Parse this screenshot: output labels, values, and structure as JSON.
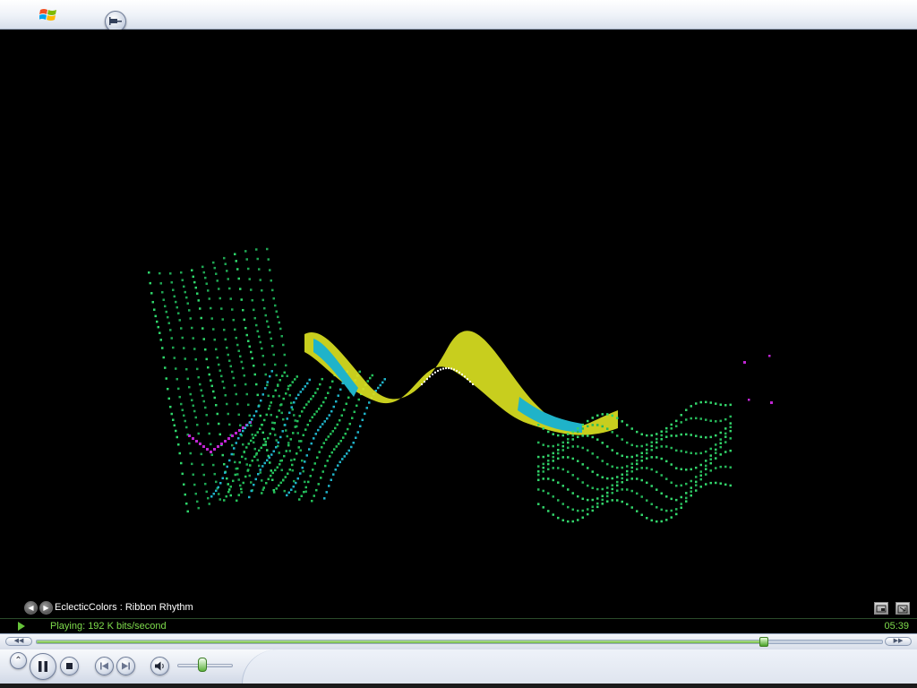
{
  "visualization": {
    "name": "EclecticColors : Ribbon Rhythm"
  },
  "status": {
    "text": "Playing: 192 K bits/second",
    "time": "05:39"
  },
  "seek": {
    "progress": 0.86
  },
  "volume": {
    "level": 0.45
  },
  "icons": {
    "windows_logo": "windows-logo-icon",
    "pin": "pin-icon",
    "prev_visualization": "chevron-left-icon",
    "next_visualization": "chevron-right-icon",
    "play_indicator": "play-icon",
    "rewind": "rewind-icon",
    "fast_forward": "fast-forward-icon",
    "eject": "eject-icon",
    "pause": "pause-icon",
    "stop": "stop-icon",
    "previous": "previous-track-icon",
    "next": "next-track-icon",
    "mute": "speaker-icon",
    "switch_to_skin": "switch-to-skin-icon",
    "full_screen": "full-screen-icon"
  },
  "colors": {
    "status_text": "#7fdc4c",
    "seek_fill": "#6fb447",
    "ribbon_green": "#22c55e",
    "ribbon_yellow": "#d9e021",
    "ribbon_cyan": "#1fb3c9",
    "ribbon_magenta": "#c026d3"
  }
}
